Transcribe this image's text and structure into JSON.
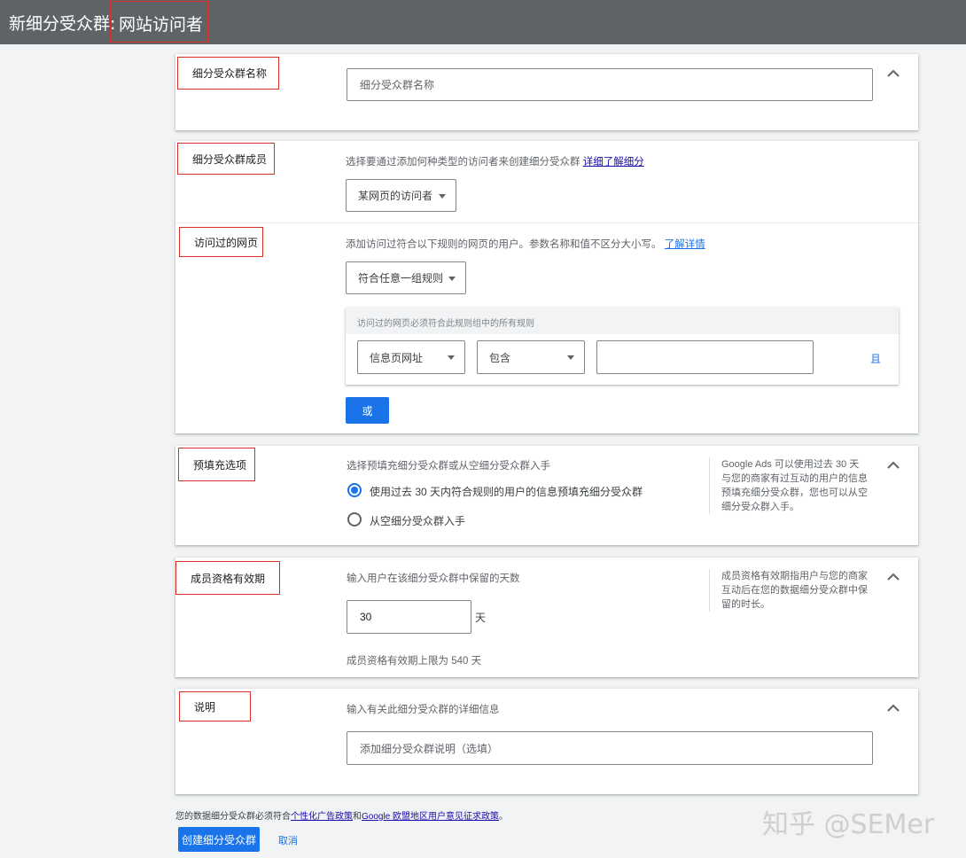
{
  "header": {
    "prefix": "新细分受众群:",
    "title": "网站访问者"
  },
  "name_section": {
    "label": "细分受众群名称",
    "input_placeholder": "细分受众群名称"
  },
  "members_section": {
    "label": "细分受众群成员",
    "description": "选择要通过添加何种类型的访问者来创建细分受众群",
    "link": "详细了解细分",
    "type_value": "某网页的访问者"
  },
  "pages_section": {
    "label": "访问过的网页",
    "description": "添加访问过符合以下规则的网页的用户。参数名称和值不区分大小写。",
    "link": "了解详情",
    "match_value": "符合任意一组规则",
    "rule_group_header": "访问过的网页必须符合此规则组中的所有规则",
    "rule_field": "信息页网址",
    "rule_operator": "包含",
    "rule_value": "",
    "and_label": "且",
    "or_button": "或"
  },
  "prefill_section": {
    "label": "预填充选项",
    "description": "选择预填充细分受众群或从空细分受众群入手",
    "options": [
      {
        "label": "使用过去 30 天内符合规则的用户的信息预填充细分受众群",
        "selected": true
      },
      {
        "label": "从空细分受众群入手",
        "selected": false
      }
    ],
    "help": "Google Ads 可以使用过去 30 天与您的商家有过互动的用户的信息预填充细分受众群，您也可以从空细分受众群入手。"
  },
  "duration_section": {
    "label": "成员资格有效期",
    "description": "输入用户在该细分受众群中保留的天数",
    "value": "30",
    "unit": "天",
    "limit_note": "成员资格有效期上限为 540 天",
    "help": "成员资格有效期指用户与您的商家互动后在您的数据细分受众群中保留的时长。"
  },
  "description_section": {
    "label": "说明",
    "description": "输入有关此细分受众群的详细信息",
    "input_placeholder": "添加细分受众群说明（选填）"
  },
  "footer": {
    "policy_prefix": "您的数据细分受众群必须符合",
    "policy_link1": "个性化广告政策",
    "policy_and": "和",
    "policy_link2": "Google 欧盟地区用户意见征求政策",
    "policy_suffix": "。",
    "create_button": "创建细分受众群",
    "cancel_button": "取消"
  },
  "watermark": "知乎 @SEMer",
  "colors": {
    "accent": "#1a73e8",
    "annotation_red": "#d93025",
    "header_bg": "#5f6368"
  }
}
